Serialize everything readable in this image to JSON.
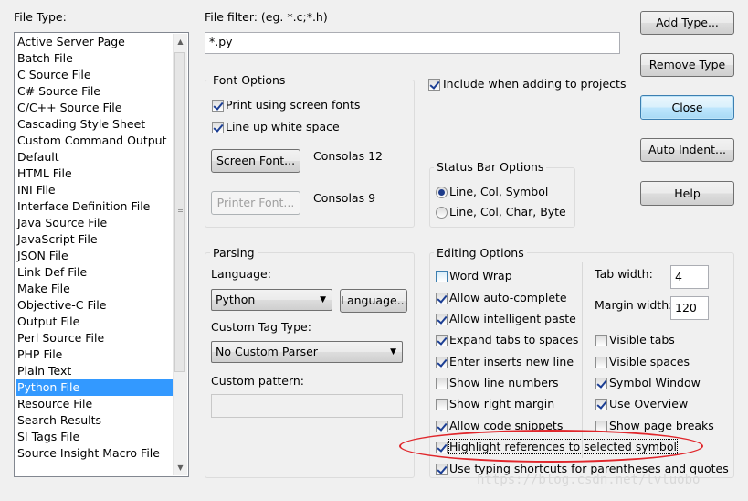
{
  "file_type_label": "File Type:",
  "file_types": [
    "Active Server Page",
    "Batch File",
    "C Source File",
    "C# Source File",
    "C/C++ Source File",
    "Cascading Style Sheet",
    "Custom Command Output",
    "Default",
    "HTML File",
    "INI File",
    "Interface Definition File",
    "Java Source File",
    "JavaScript File",
    "JSON File",
    "Link Def File",
    "Make File",
    "Objective-C File",
    "Output File",
    "Perl Source File",
    "PHP File",
    "Plain Text",
    "Python File",
    "Resource File",
    "Search Results",
    "SI Tags File",
    "Source Insight Macro File"
  ],
  "selected_file_type": "Python File",
  "file_filter": {
    "label": "File filter: (eg. *.c;*.h)",
    "value": "*.py"
  },
  "font_options": {
    "title": "Font Options",
    "print_screen_fonts": {
      "label": "Print using screen fonts",
      "checked": true
    },
    "line_up_white_space": {
      "label": "Line up white space",
      "checked": true
    },
    "screen_font_button": "Screen Font...",
    "screen_font_value": "Consolas 12",
    "printer_font_button": "Printer Font...",
    "printer_font_value": "Consolas 9"
  },
  "include_when_adding": {
    "label": "Include when adding to projects",
    "checked": true
  },
  "status_bar": {
    "title": "Status Bar Options",
    "options": [
      "Line, Col, Symbol",
      "Line, Col, Char, Byte"
    ],
    "selected": "Line, Col, Symbol"
  },
  "parsing": {
    "title": "Parsing",
    "language_label": "Language:",
    "language_value": "Python",
    "language_button": "Language...",
    "custom_tag_type_label": "Custom Tag Type:",
    "custom_tag_type_value": "No Custom Parser",
    "custom_pattern_label": "Custom pattern:",
    "custom_pattern_value": ""
  },
  "editing": {
    "title": "Editing Options",
    "left_checks": [
      {
        "label": "Word Wrap",
        "checked": false
      },
      {
        "label": "Allow auto-complete",
        "checked": true
      },
      {
        "label": "Allow intelligent paste",
        "checked": true
      },
      {
        "label": "Expand tabs to spaces",
        "checked": true
      },
      {
        "label": "Enter inserts new line",
        "checked": true
      },
      {
        "label": "Show line numbers",
        "checked": false
      },
      {
        "label": "Show right margin",
        "checked": false
      },
      {
        "label": "Allow code snippets",
        "checked": true
      },
      {
        "label": "Highlight references to selected symbol",
        "checked": true
      },
      {
        "label": "Use typing shortcuts for parentheses and quotes",
        "checked": true
      }
    ],
    "tab_width_label": "Tab width:",
    "tab_width_value": "4",
    "margin_width_label": "Margin width:",
    "margin_width_value": "120",
    "right_checks": [
      {
        "label": "Visible tabs",
        "checked": false
      },
      {
        "label": "Visible spaces",
        "checked": false
      },
      {
        "label": "Symbol Window",
        "checked": true
      },
      {
        "label": "Use Overview",
        "checked": true
      },
      {
        "label": "Show page breaks",
        "checked": false
      }
    ]
  },
  "buttons": {
    "add_type": "Add Type...",
    "remove_type": "Remove Type",
    "close": "Close",
    "auto_indent": "Auto Indent...",
    "help": "Help"
  },
  "watermark": "https://blog.csdn.net/lvluobo",
  "colors": {
    "selection": "#3399ff",
    "annotation": "#e0262b",
    "default_button": "#3c7fb1"
  }
}
